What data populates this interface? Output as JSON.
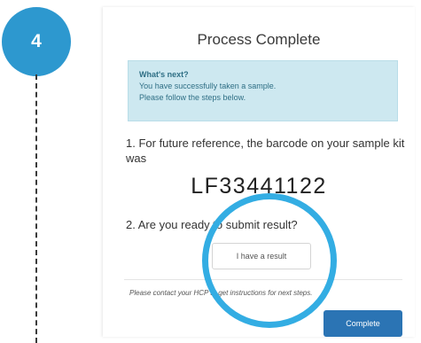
{
  "step": {
    "number": "4"
  },
  "card": {
    "title": "Process Complete",
    "info": {
      "heading": "What's next?",
      "line1": "You have successfully taken a sample.",
      "line2": "Please follow the steps below."
    },
    "future_reference_text": "1. For future reference, the barcode on your sample kit was",
    "barcode": "LF33441122",
    "ready_text": "2. Are you ready to submit result?",
    "result_button_label": "I have a result",
    "contact_text": "Please contact your HCP to get instructions for next steps.",
    "complete_button_label": "Complete"
  },
  "colors": {
    "step_circle": "#2d98cf",
    "highlight_ring": "#33ade3",
    "info_background": "#cde8f0",
    "complete_button": "#2b74b4"
  }
}
